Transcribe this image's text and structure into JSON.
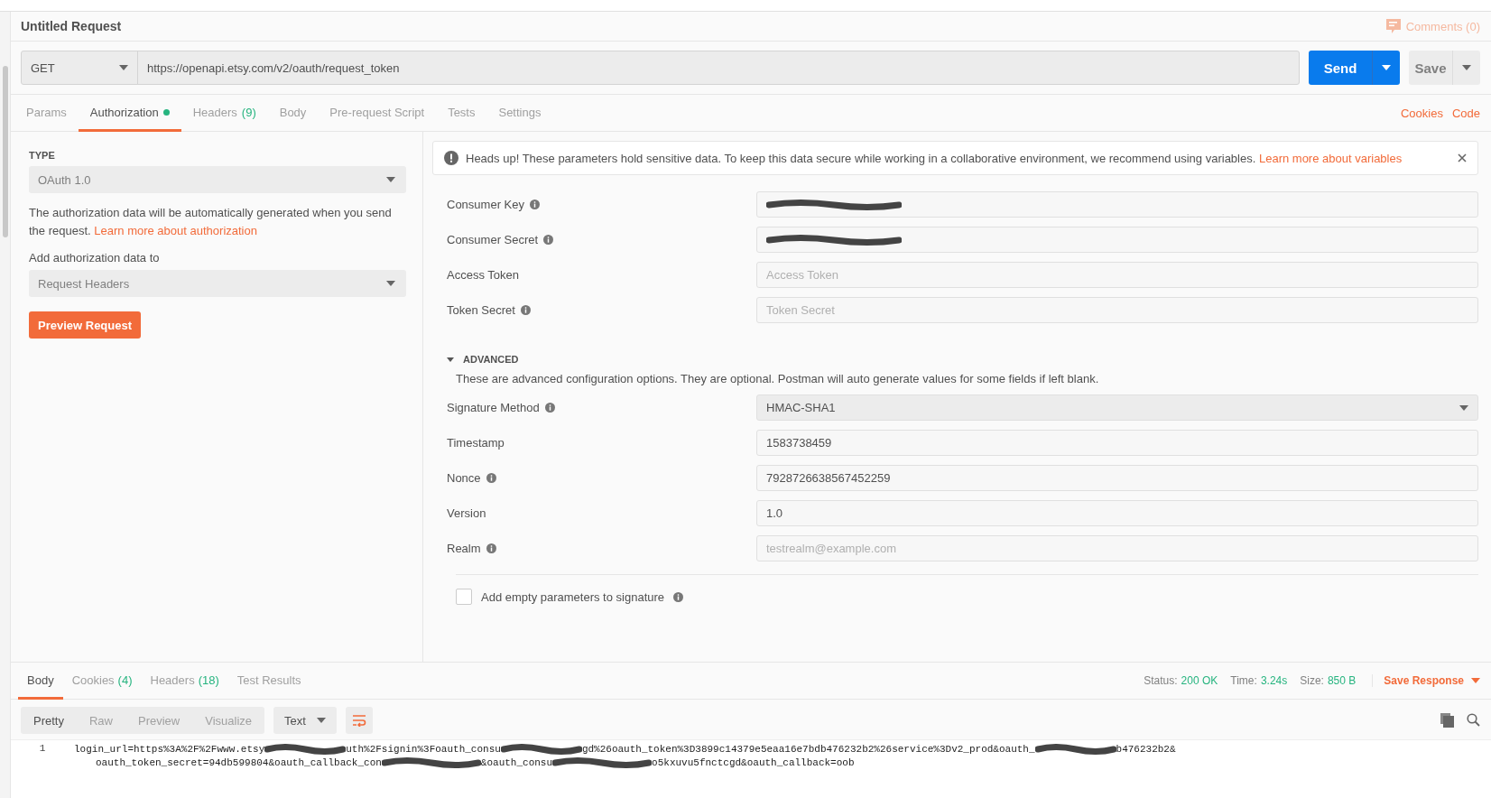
{
  "request": {
    "title": "Untitled Request",
    "comments": "Comments (0)",
    "method": "GET",
    "url": "https://openapi.etsy.com/v2/oauth/request_token",
    "send": "Send",
    "save": "Save"
  },
  "tabs": [
    {
      "label": "Params",
      "selected": false
    },
    {
      "label": "Authorization",
      "selected": true,
      "dot": true
    },
    {
      "label": "Headers",
      "count": "(9)",
      "selected": false
    },
    {
      "label": "Body",
      "selected": false
    },
    {
      "label": "Pre-request Script",
      "selected": false
    },
    {
      "label": "Tests",
      "selected": false
    },
    {
      "label": "Settings",
      "selected": false
    }
  ],
  "tab_links": [
    "Cookies",
    "Code"
  ],
  "auth": {
    "type_label": "TYPE",
    "type": "OAuth 1.0",
    "description": "The authorization data will be automatically generated when you send the request.",
    "learn_more": "Learn more about authorization",
    "add_to_label": "Add authorization data to",
    "add_to": "Request Headers",
    "preview": "Preview Request"
  },
  "notice": {
    "text": "Heads up! These parameters hold sensitive data. To keep this data secure while working in a collaborative environment, we recommend using variables.",
    "link": "Learn more about variables"
  },
  "fields": [
    {
      "label": "Consumer Key",
      "info": true,
      "kind": "redacted"
    },
    {
      "label": "Consumer Secret",
      "info": true,
      "kind": "redacted"
    },
    {
      "label": "Access Token",
      "info": false,
      "kind": "text",
      "placeholder": "Access Token"
    },
    {
      "label": "Token Secret",
      "info": true,
      "kind": "text",
      "placeholder": "Token Secret"
    }
  ],
  "advanced": {
    "title": "ADVANCED",
    "expanded": true,
    "description": "These are advanced configuration options. They are optional. Postman will auto generate values for some fields if left blank."
  },
  "advanced_fields": [
    {
      "label": "Signature Method",
      "info": true,
      "kind": "select",
      "value": "HMAC-SHA1"
    },
    {
      "label": "Timestamp",
      "info": false,
      "kind": "text",
      "value": "1583738459"
    },
    {
      "label": "Nonce",
      "info": true,
      "kind": "text",
      "value": "7928726638567452259"
    },
    {
      "label": "Version",
      "info": false,
      "kind": "text",
      "value": "1.0"
    },
    {
      "label": "Realm",
      "info": true,
      "kind": "text",
      "placeholder": "testrealm@example.com"
    }
  ],
  "empty_params": {
    "label": "Add empty parameters to signature",
    "checked": false
  },
  "response": {
    "tabs": [
      {
        "label": "Body",
        "selected": true
      },
      {
        "label": "Cookies",
        "count": "(4)",
        "selected": false
      },
      {
        "label": "Headers",
        "count": "(18)",
        "selected": false
      },
      {
        "label": "Test Results",
        "selected": false
      }
    ],
    "status_label": "Status:",
    "status": "200 OK",
    "time_label": "Time:",
    "time": "3.24s",
    "size_label": "Size:",
    "size": "850 B",
    "save": "Save Response",
    "views": [
      {
        "label": "Pretty",
        "selected": true
      },
      {
        "label": "Raw",
        "selected": false
      },
      {
        "label": "Preview",
        "selected": false
      },
      {
        "label": "Visualize",
        "selected": false
      }
    ],
    "format": "Text",
    "line_number": "1",
    "lines": [
      [
        "login_url=https%3A%2F%2Fwww.etsy",
        "uth%2Fsignin%3Foauth_consu",
        "gd%26oauth_token%3D3899c14379e5eaa16e7bdb476232b2%26service%3Dv2_prod&oauth_",
        "b476232b2&"
      ],
      [
        "oauth_token_secret=94db599804&oauth_callback_con",
        "&oauth_consu",
        "o5kxuvu5fnctcgd&oauth_callback=oob"
      ]
    ]
  }
}
